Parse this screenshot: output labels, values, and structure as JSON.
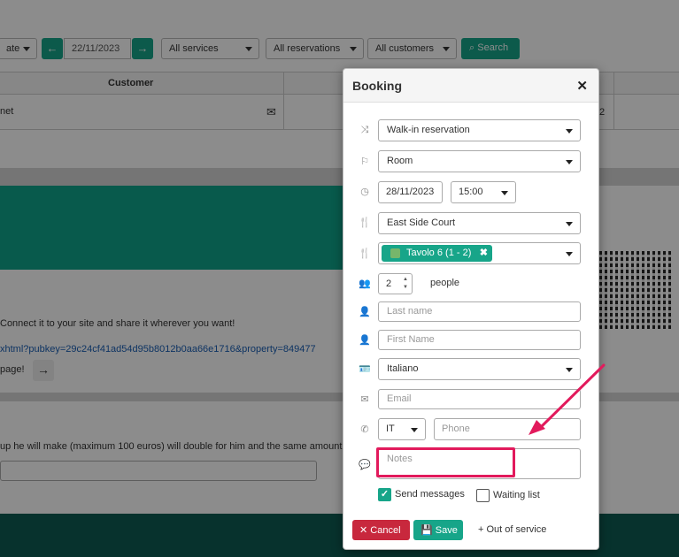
{
  "toolbar": {
    "date_select": "ate",
    "date_value": "22/11/2023",
    "services_select": "All services",
    "reservations_select": "All reservations",
    "customers_select": "All customers",
    "search_label": "Search",
    "prev_icon": "arrow-left-icon",
    "next_icon": "arrow-right-icon"
  },
  "table": {
    "header_customer": "Customer",
    "row_customer_fragment": "net",
    "row_trailing": "2",
    "mail_icon": "envelope-icon"
  },
  "background": {
    "share_text": "Connect it to your site and share it wherever you want!",
    "share_link": "xhtml?pubkey=29c24cf41ad54d95b8012b0aa66e1716&property=849477",
    "page_text": "page!",
    "referral_text": "up he will make (maximum 100 euros) will double for him and the same amount"
  },
  "modal": {
    "title": "Booking",
    "reservation_type": "Walk-in reservation",
    "room": "Room",
    "date": "28/11/2023",
    "time": "15:00",
    "area": "East Side Court",
    "table_tag": "Tavolo 6 (1 - 2)",
    "people_count": "2",
    "people_label": "people",
    "last_name_placeholder": "Last name",
    "first_name_placeholder": "First Name",
    "language": "Italiano",
    "email_placeholder": "Email",
    "phone_country": "IT",
    "phone_placeholder": "Phone",
    "notes_placeholder": "Notes",
    "send_messages_label": "Send messages",
    "send_messages_checked": true,
    "waiting_list_label": "Waiting list",
    "waiting_list_checked": false,
    "cancel_label": "Cancel",
    "save_label": "Save",
    "out_of_service_label": "Out of service"
  },
  "colors": {
    "accent": "#17a589",
    "danger": "#c8283d",
    "annotation": "#e21a5c",
    "footer": "#0e5b52"
  }
}
